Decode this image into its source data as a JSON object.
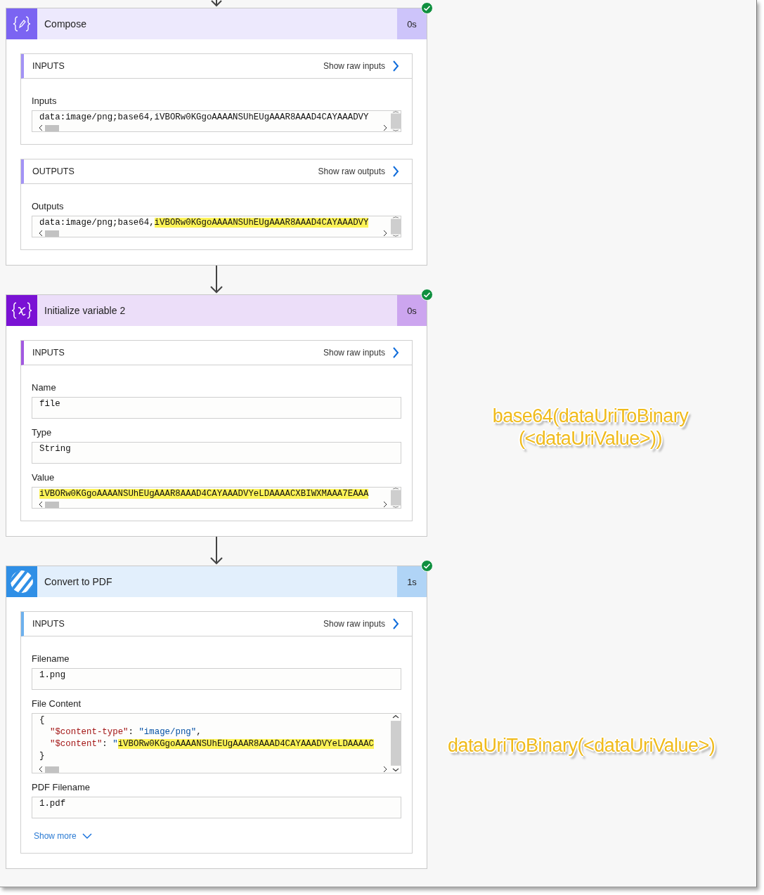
{
  "cards": [
    {
      "title": "Compose",
      "kind": "compose",
      "color": "#7b64f2",
      "duration": "0s",
      "succeeded": true,
      "sections": [
        {
          "heading": "INPUTS",
          "raw_link": "Show raw inputs",
          "fields": [
            {
              "label": "Inputs",
              "kind": "scroll",
              "lines": [
                [
                  {
                    "text": "data:image/png;base64,iVBORw0KGgoAAAANSUhEUgAAAR8AAAD4CAYAAADVY",
                    "kind": "plain",
                    "highlighted": false
                  }
                ]
              ]
            }
          ]
        },
        {
          "heading": "OUTPUTS",
          "raw_link": "Show raw outputs",
          "fields": [
            {
              "label": "Outputs",
              "kind": "scroll",
              "lines": [
                [
                  {
                    "text": "data:image/png;base64,",
                    "kind": "plain",
                    "highlighted": false
                  },
                  {
                    "text": "iVBORw0KGgoAAAANSUhEUgAAAR8AAAD4CAYAAADVY",
                    "kind": "plain",
                    "highlighted": true
                  }
                ]
              ]
            }
          ]
        }
      ]
    },
    {
      "title": "Initialize variable 2",
      "kind": "variable",
      "color": "#7a12d4",
      "duration": "0s",
      "succeeded": true,
      "sections": [
        {
          "heading": "INPUTS",
          "raw_link": "Show raw inputs",
          "fields": [
            {
              "label": "Name",
              "kind": "text",
              "lines": [
                [
                  {
                    "text": "file",
                    "kind": "plain",
                    "highlighted": false
                  }
                ]
              ]
            },
            {
              "label": "Type",
              "kind": "text",
              "lines": [
                [
                  {
                    "text": "String",
                    "kind": "plain",
                    "highlighted": false
                  }
                ]
              ]
            },
            {
              "label": "Value",
              "kind": "scroll",
              "lines": [
                [
                  {
                    "text": "iVBORw0KGgoAAAANSUhEUgAAAR8AAAD4CAYAAADVYeLDAAAACXBIWXMAAA7EAAA",
                    "kind": "plain",
                    "highlighted": true
                  }
                ]
              ]
            }
          ]
        }
      ]
    },
    {
      "title": "Convert to PDF",
      "kind": "connector",
      "color": "#2f8fe6",
      "duration": "1s",
      "succeeded": true,
      "sections": [
        {
          "heading": "INPUTS",
          "raw_link": "Show raw inputs",
          "fields": [
            {
              "label": "Filename",
              "kind": "text",
              "lines": [
                [
                  {
                    "text": "1.png",
                    "kind": "plain",
                    "highlighted": false
                  }
                ]
              ]
            },
            {
              "label": "File Content",
              "kind": "code",
              "lines": [
                [
                  {
                    "text": "{",
                    "kind": "punct",
                    "highlighted": false
                  }
                ],
                [
                  {
                    "text": "\"$content-type\"",
                    "kind": "key",
                    "highlighted": false
                  },
                  {
                    "text": ": ",
                    "kind": "punct",
                    "highlighted": false
                  },
                  {
                    "text": "\"image/png\"",
                    "kind": "string",
                    "highlighted": false
                  },
                  {
                    "text": ",",
                    "kind": "punct",
                    "highlighted": false
                  }
                ],
                [
                  {
                    "text": "\"$content\"",
                    "kind": "key",
                    "highlighted": false
                  },
                  {
                    "text": ": ",
                    "kind": "punct",
                    "highlighted": false
                  },
                  {
                    "text": "\"",
                    "kind": "string",
                    "highlighted": false
                  },
                  {
                    "text": "iVBORw0KGgoAAAANSUhEUgAAAR8AAAD4CAYAAADVYeLDAAAAC",
                    "kind": "string",
                    "highlighted": true
                  }
                ],
                [
                  {
                    "text": "}",
                    "kind": "punct",
                    "highlighted": false
                  }
                ]
              ]
            },
            {
              "label": "PDF Filename",
              "kind": "text",
              "lines": [
                [
                  {
                    "text": "1.pdf",
                    "kind": "plain",
                    "highlighted": false
                  }
                ]
              ]
            }
          ],
          "show_more": "Show more"
        }
      ]
    }
  ],
  "annotations": [
    {
      "text": "base64(dataUriToBinary (<dataUriValue>))"
    },
    {
      "text": "dataUriToBinary(<dataUriValue>)"
    }
  ]
}
